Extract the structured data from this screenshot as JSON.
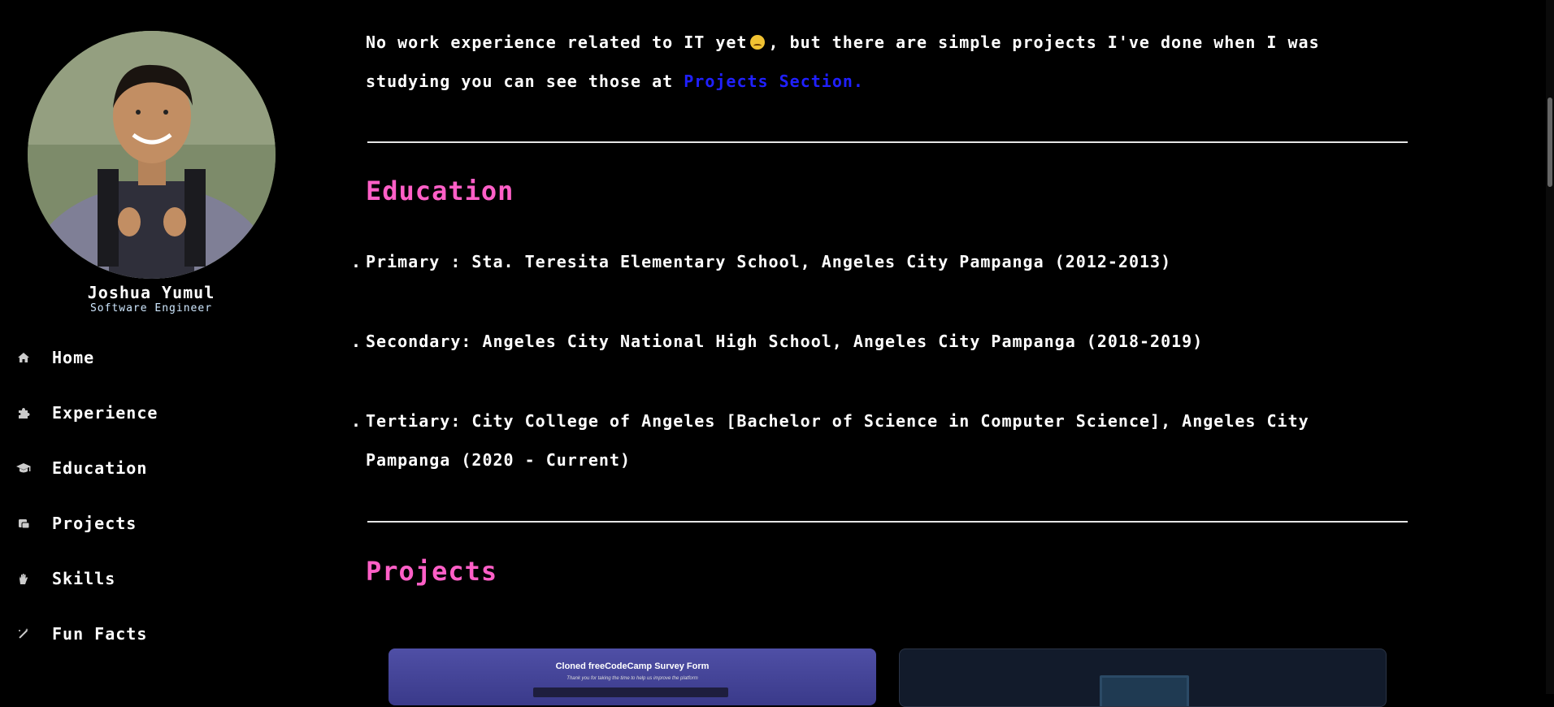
{
  "profile": {
    "name": "Joshua Yumul",
    "role": "Software Engineer"
  },
  "nav": [
    {
      "label": "Home",
      "icon": "home-icon"
    },
    {
      "label": "Experience",
      "icon": "puzzle-icon"
    },
    {
      "label": "Education",
      "icon": "graduation-cap-icon"
    },
    {
      "label": "Projects",
      "icon": "scroll-icon"
    },
    {
      "label": "Skills",
      "icon": "hand-icon"
    },
    {
      "label": "Fun Facts",
      "icon": "magic-wand-icon"
    }
  ],
  "experience": {
    "text_before": "No work experience related to IT yet",
    "text_after": ", but there are simple projects I've done when I was studying you can see those at",
    "link": "Projects Section."
  },
  "education": {
    "title": "Education",
    "items": [
      "Primary : Sta. Teresita Elementary School, Angeles City Pampanga (2012-2013)",
      "Secondary: Angeles City National High School, Angeles City Pampanga (2018-2019)",
      "Tertiary: City College of Angeles [Bachelor of Science in Computer Science], Angeles City Pampanga (2020 - Current)"
    ]
  },
  "projects": {
    "title": "Projects",
    "cards": [
      {
        "title": "Cloned freeCodeCamp Survey Form",
        "subtitle": "Thank you for taking the time to help us improve the platform"
      },
      {
        "title": ""
      }
    ]
  },
  "colors": {
    "background": "#000000",
    "accent": "#ff5fc7",
    "link": "#2020ff"
  }
}
